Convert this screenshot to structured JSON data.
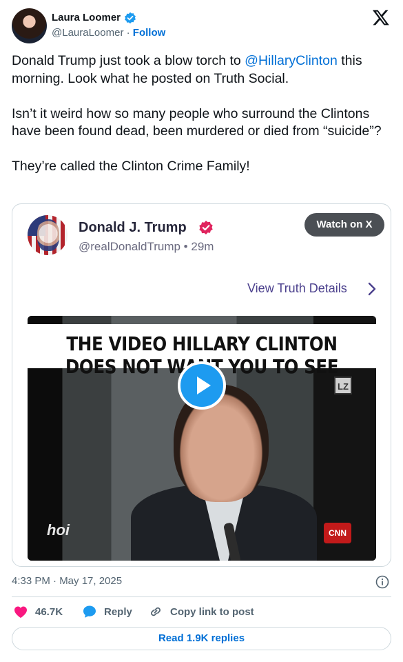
{
  "tweet": {
    "author": {
      "name": "Laura Loomer",
      "handle": "@LauraLoomer",
      "separator": "·",
      "follow_label": "Follow"
    },
    "text": {
      "line1_prefix": "Donald Trump just took a blow torch to ",
      "mention": "@HillaryClinton",
      "line1_suffix": " this morning. Look what he posted on Truth Social.",
      "para2": "Isn’t it weird how so many people who surround the Clintons have been found dead, been murdered or died from “suicide”?",
      "para3": "They’re called the Clinton Crime Family!"
    },
    "timestamp": "4:33 PM · May 17, 2025",
    "likes": "46.7K",
    "reply_label": "Reply",
    "copy_link_label": "Copy link to post",
    "read_replies_label": "Read 1.9K replies"
  },
  "embed": {
    "name": "Donald J. Trump",
    "handle_time": "@realDonaldTrump • 29m",
    "watch_label": "Watch on X",
    "view_details_label": "View Truth Details",
    "video": {
      "banner_line1": "THE VIDEO HILLARY CLINTON",
      "banner_line2": "DOES NOT WANT YOU TO SEE",
      "corner_logo": "LZ",
      "left_logo": "hoi",
      "right_logo": "CNN"
    }
  },
  "colors": {
    "accent": "#1d9bf0",
    "link": "#006fd6",
    "like": "#f91880",
    "text": "#0f1419",
    "muted": "#536471"
  },
  "icons": [
    "verified-badge-icon",
    "x-logo-icon",
    "chevron-right-icon",
    "play-icon",
    "info-icon",
    "heart-icon",
    "reply-bubble-icon",
    "link-icon"
  ]
}
